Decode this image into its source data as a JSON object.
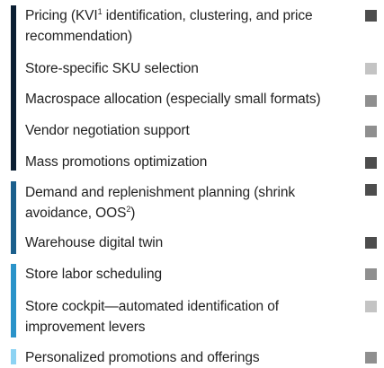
{
  "items": [
    {
      "label_pre": "Pricing (KVI",
      "label_sup": "1",
      "label_post": " identification, clustering, and price recommendation)",
      "bar_color": "#0b1f33",
      "square_color": "#4d4d4d"
    },
    {
      "label": "Store-specific SKU selection",
      "bar_color": "#0b1f33",
      "square_color": "#c4c4c4"
    },
    {
      "label": "Macrospace allocation (especially small formats)",
      "bar_color": "#0b1f33",
      "square_color": "#8f8f8f"
    },
    {
      "label": "Vendor negotiation support",
      "bar_color": "#0b1f33",
      "square_color": "#8f8f8f"
    },
    {
      "label": "Mass promotions optimization",
      "bar_color": "#0b1f33",
      "square_color": "#4d4d4d"
    },
    {
      "label_pre": "Demand and replenishment planning (shrink avoidance, OOS",
      "label_sup": "2",
      "label_post": ")",
      "bar_color": "#1b5f8c",
      "square_color": "#4d4d4d"
    },
    {
      "label": "Warehouse digital twin",
      "bar_color": "#1b5f8c",
      "square_color": "#4d4d4d"
    },
    {
      "label": "Store labor scheduling",
      "bar_color": "#2a93c9",
      "square_color": "#8f8f8f"
    },
    {
      "label": "Store cockpit—automated identification of improvement levers",
      "bar_color": "#2a93c9",
      "square_color": "#c4c4c4"
    },
    {
      "label": "Personalized promotions and offerings",
      "bar_color": "#8dd3f3",
      "square_color": "#8f8f8f"
    }
  ]
}
